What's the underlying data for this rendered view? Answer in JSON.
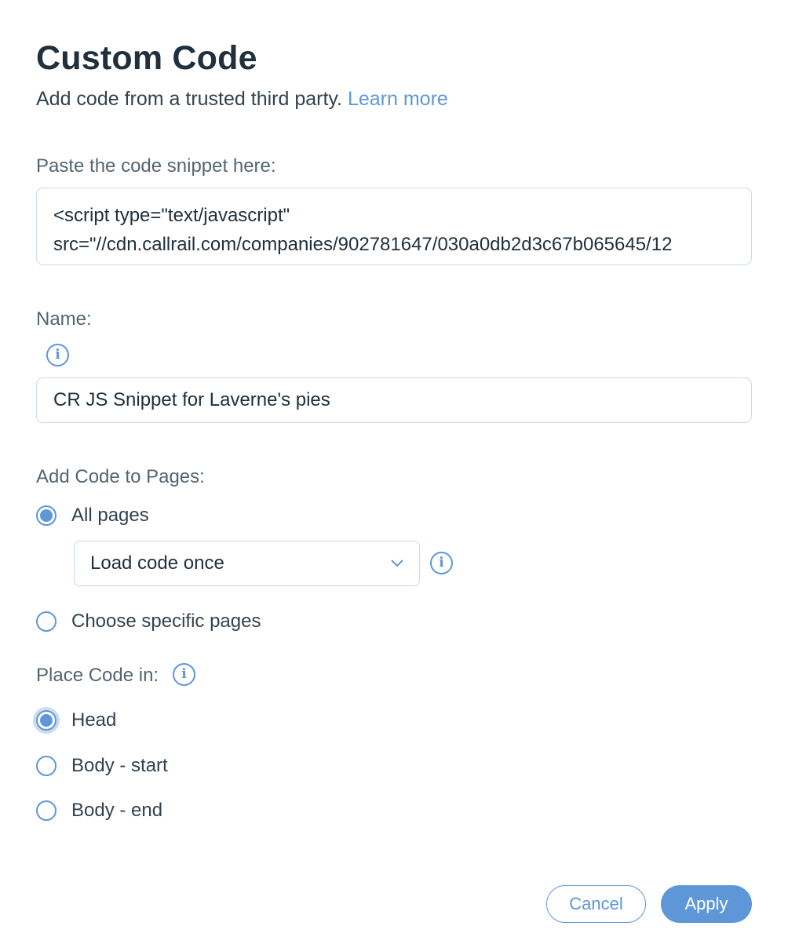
{
  "dialog": {
    "title": "Custom Code",
    "subtitle": "Add code from a trusted third party.",
    "learn_more": "Learn more"
  },
  "snippet": {
    "label": "Paste the code snippet here:",
    "lines": [
      "<script type=\"text/javascript\"",
      "src=\"//cdn.callrail.com/companies/902781647/030a0db2d3c67b065645/12"
    ]
  },
  "name_field": {
    "label": "Name:",
    "value": "CR JS Snippet for Laverne's pies",
    "info_icon": "info-icon"
  },
  "pages": {
    "label": "Add Code to Pages:",
    "options": [
      {
        "label": "All pages",
        "checked": true
      },
      {
        "label": "Choose specific pages",
        "checked": false
      }
    ],
    "load_select": {
      "value": "Load code once",
      "icon": "chevron-down-icon"
    }
  },
  "placement": {
    "label": "Place Code in:",
    "options": [
      {
        "label": "Head",
        "checked": true
      },
      {
        "label": "Body - start",
        "checked": false
      },
      {
        "label": "Body - end",
        "checked": false
      }
    ]
  },
  "buttons": {
    "cancel": "Cancel",
    "apply": "Apply"
  },
  "colors": {
    "accent": "#5e97d8",
    "input_border": "#c7daf2",
    "title_text": "#20303c"
  }
}
